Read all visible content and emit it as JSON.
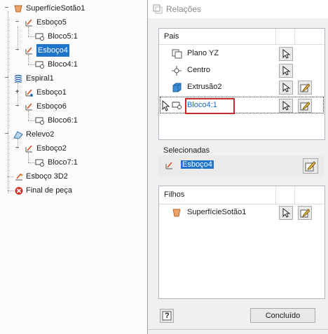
{
  "tree": {
    "items": [
      {
        "label": "SuperfícieSotão1",
        "icon": "loft-surface-icon"
      },
      {
        "label": "Esboço5",
        "icon": "sketch-icon"
      },
      {
        "label": "Bloco5:1",
        "icon": "block-icon"
      },
      {
        "label": "Esboço4",
        "icon": "sketch-icon",
        "selected": true
      },
      {
        "label": "Bloco4:1",
        "icon": "block-icon"
      },
      {
        "label": "Espiral1",
        "icon": "coil-icon"
      },
      {
        "label": "Esboço1",
        "icon": "sketch-icon"
      },
      {
        "label": "Esboço6",
        "icon": "sketch-icon"
      },
      {
        "label": "Bloco6:1",
        "icon": "block-icon"
      },
      {
        "label": "Relevo2",
        "icon": "emboss-icon"
      },
      {
        "label": "Esboço2",
        "icon": "sketch-icon"
      },
      {
        "label": "Bloco7:1",
        "icon": "block-icon"
      },
      {
        "label": "Esboço 3D2",
        "icon": "sketch3d-icon"
      },
      {
        "label": "Final de peça",
        "icon": "end-of-part-icon"
      }
    ]
  },
  "dialog": {
    "title": "Relações",
    "parents": {
      "header": "Pais",
      "rows": [
        {
          "label": "Plano YZ",
          "icon": "plane-icon"
        },
        {
          "label": "Centro",
          "icon": "center-point-icon"
        },
        {
          "label": "Extrusão2",
          "icon": "extrude-icon"
        },
        {
          "label": "Bloco4:1",
          "icon": "block-icon"
        }
      ]
    },
    "selected": {
      "label": "Selecionadas",
      "value": "Esboço4"
    },
    "children": {
      "header": "Filhos",
      "rows": [
        {
          "label": "SuperfícieSotão1",
          "icon": "loft-surface-icon"
        }
      ]
    },
    "done_label": "Concluído",
    "help_label": "?"
  },
  "colors": {
    "selection": "#1e74c9",
    "highlight_box": "#c12d2d",
    "link": "#1a66c4"
  }
}
